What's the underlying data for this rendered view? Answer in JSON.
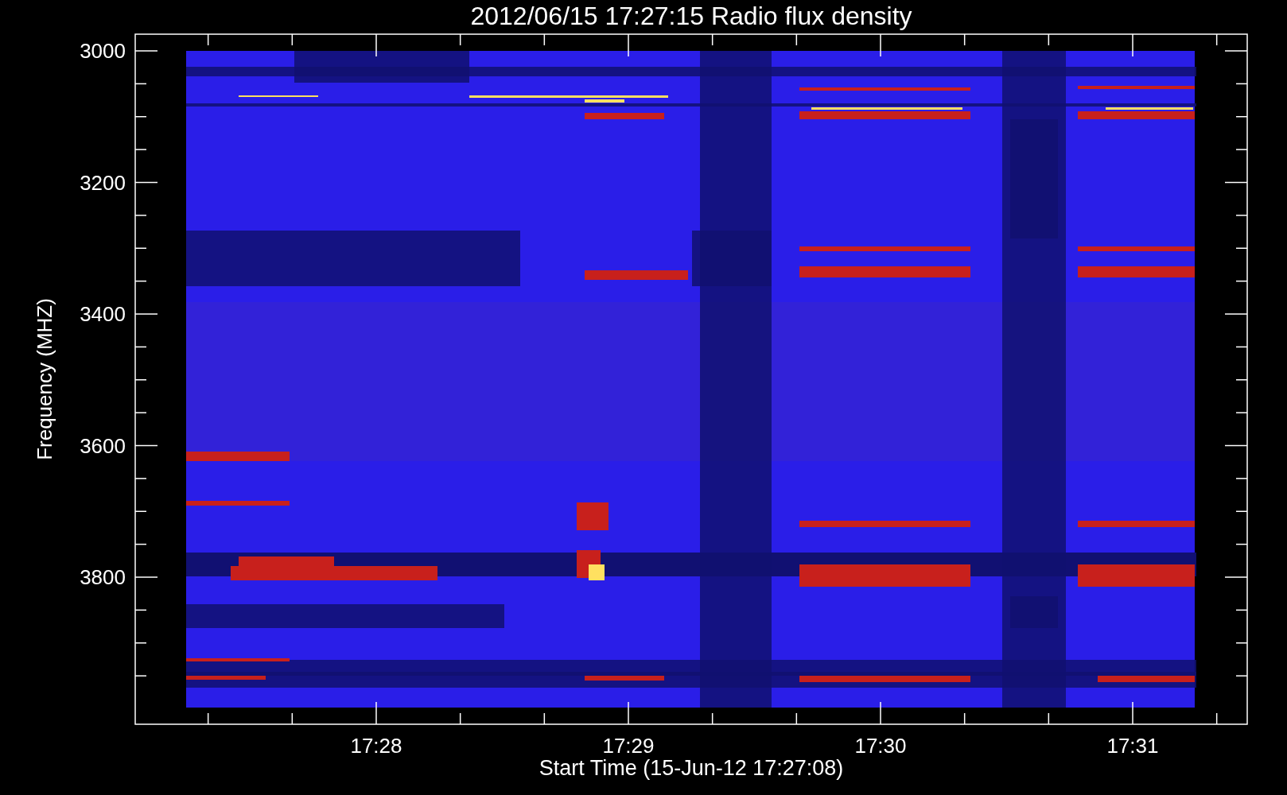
{
  "title": "2012/06/15 17:27:15 Radio flux density",
  "y_axis": {
    "label": "Frequency (MHZ)",
    "ticks": [
      "3000",
      "3200",
      "3400",
      "3600",
      "3800"
    ]
  },
  "x_axis": {
    "label": "Start Time (15-Jun-12 17:27:08)",
    "ticks": [
      "17:28",
      "17:29",
      "17:30",
      "17:31"
    ]
  }
}
